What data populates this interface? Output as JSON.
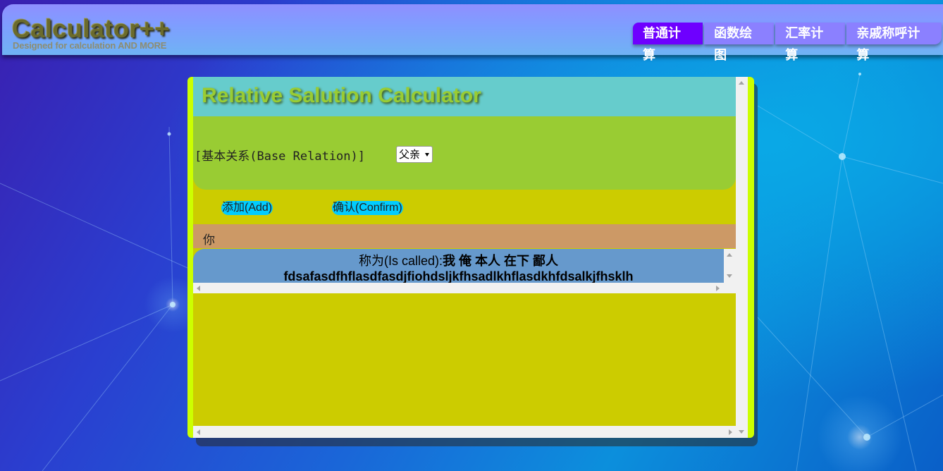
{
  "header": {
    "logo_title": "Calculator++",
    "logo_subtitle": "Designed for calculation AND MORE"
  },
  "nav": {
    "tabs": [
      "普通计算",
      "函数绘图",
      "汇率计算",
      "亲戚称呼计算"
    ],
    "active_index": 0
  },
  "panel": {
    "title": "Relative Salution Calculator",
    "relation_label": "[基本关系(Base Relation)]",
    "relation_selected": "父亲",
    "add_button": "添加(Add)",
    "confirm_button": "确认(Confirm)",
    "you_text": "你",
    "result_prefix": "称为(Is called):",
    "result_values": "我 俺 本人 在下 鄙人",
    "result_line2": "fdsafasdfhflasdfasdjfiohdsljkfhsadlkhflasdkhfdsalkjfhsklh"
  },
  "colors": {
    "header_gradient_top": "#8f8fff",
    "active_tab": "#6e00ff",
    "inactive_tab": "#8b80ff",
    "panel_border": "#ccff00",
    "panel_background": "#cccc00",
    "title_bar": "#66cccc",
    "title_text": "#99cc33",
    "relation_box": "#99cc33",
    "button_bg": "#00ccff",
    "you_bar": "#cc9966",
    "result_box": "#6699cc"
  }
}
